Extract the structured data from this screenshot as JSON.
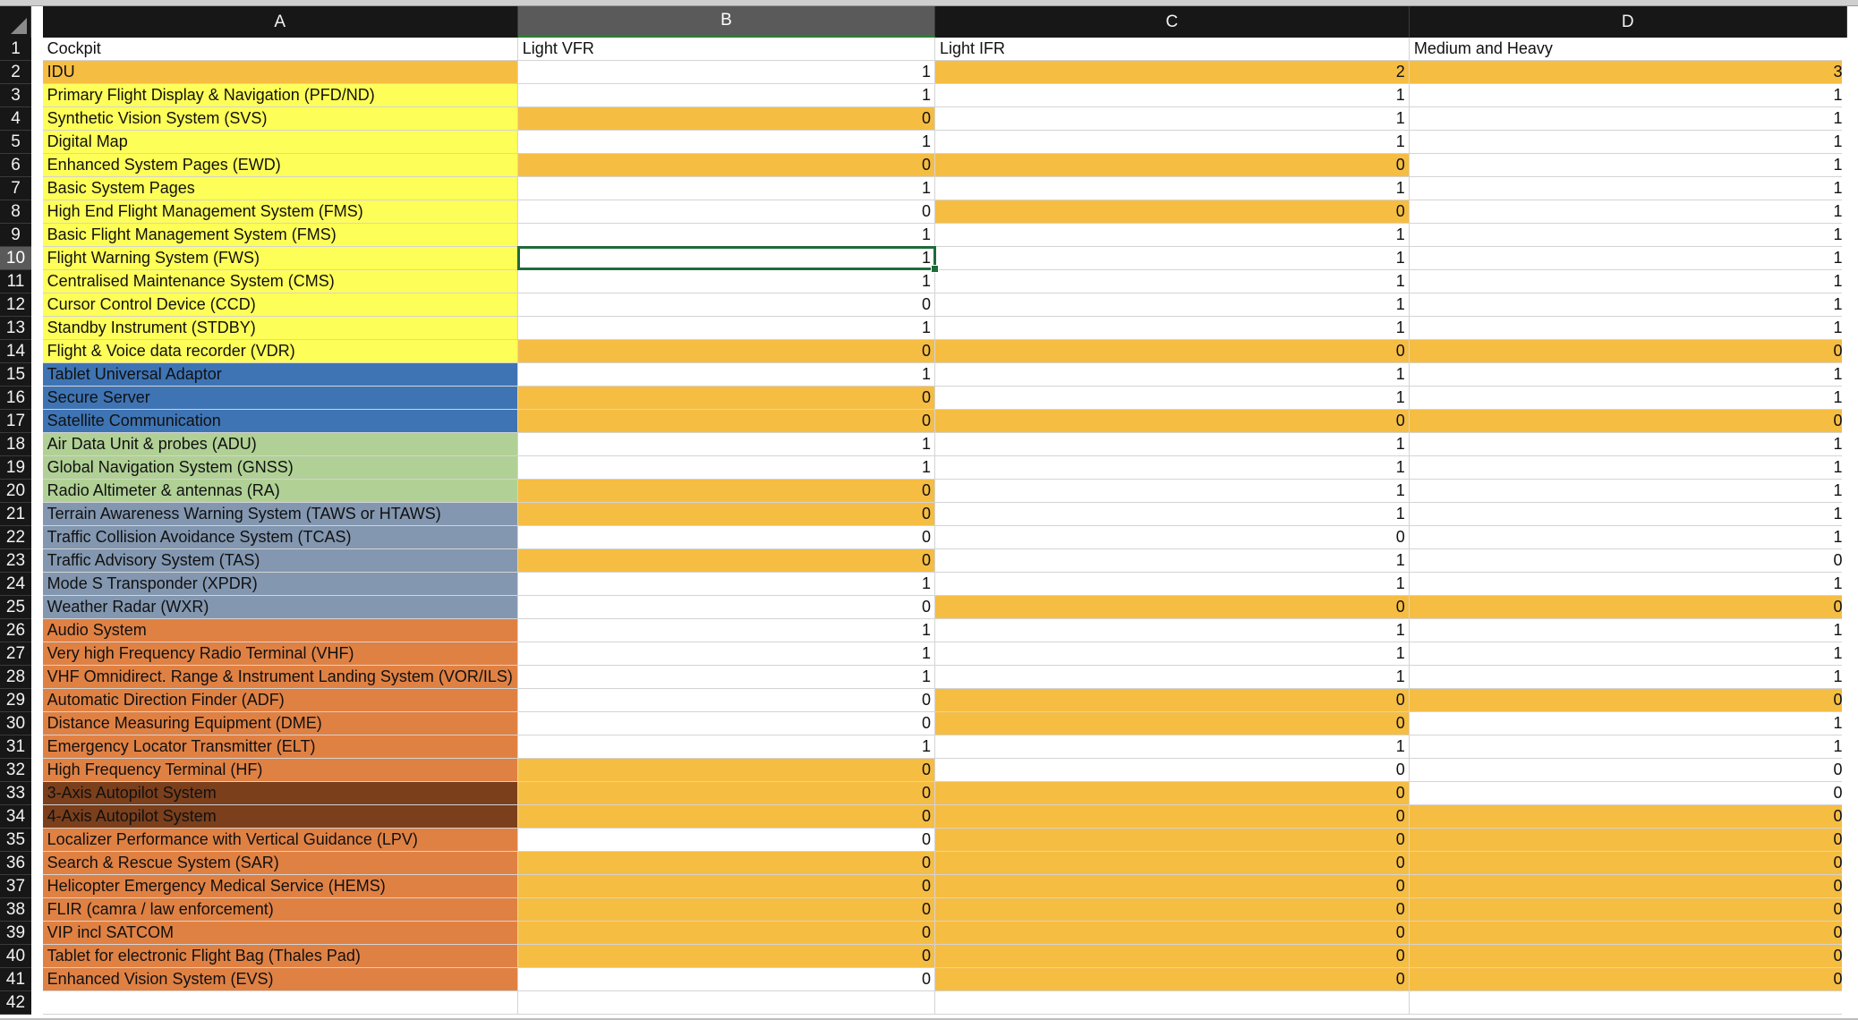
{
  "columns": [
    "A",
    "B",
    "C",
    "D"
  ],
  "selected_column": "B",
  "selected_row": 10,
  "colors": {
    "orange": "#f6bd43",
    "yellow": "#fefe58",
    "blue": "#3f74b4",
    "green": "#b0d095",
    "slate": "#8397b0",
    "copper": "#e08144",
    "brown": "#7b3f1c",
    "white": "#ffffff",
    "selection": "#1e6b3a"
  },
  "rows": [
    {
      "n": 1,
      "a": "Cockpit",
      "b": "Light VFR",
      "c": "Light IFR",
      "d": "Medium and Heavy",
      "fa": "white",
      "fb": "white",
      "fc": "white",
      "fd": "white",
      "header": true
    },
    {
      "n": 2,
      "a": "IDU",
      "b": "1",
      "c": "2",
      "d": "3",
      "fa": "orange",
      "fb": "white",
      "fc": "orange",
      "fd": "orange"
    },
    {
      "n": 3,
      "a": "Primary Flight Display & Navigation (PFD/ND)",
      "b": "1",
      "c": "1",
      "d": "1",
      "fa": "yellow",
      "fb": "white",
      "fc": "white",
      "fd": "white"
    },
    {
      "n": 4,
      "a": "Synthetic Vision System (SVS)",
      "b": "0",
      "c": "1",
      "d": "1",
      "fa": "yellow",
      "fb": "orange",
      "fc": "white",
      "fd": "white"
    },
    {
      "n": 5,
      "a": "Digital Map",
      "b": "1",
      "c": "1",
      "d": "1",
      "fa": "yellow",
      "fb": "white",
      "fc": "white",
      "fd": "white"
    },
    {
      "n": 6,
      "a": "Enhanced System Pages (EWD)",
      "b": "0",
      "c": "0",
      "d": "1",
      "fa": "yellow",
      "fb": "orange",
      "fc": "orange",
      "fd": "white"
    },
    {
      "n": 7,
      "a": "Basic System Pages",
      "b": "1",
      "c": "1",
      "d": "1",
      "fa": "yellow",
      "fb": "white",
      "fc": "white",
      "fd": "white"
    },
    {
      "n": 8,
      "a": "High End Flight Management System (FMS)",
      "b": "0",
      "c": "0",
      "d": "1",
      "fa": "yellow",
      "fb": "white",
      "fc": "orange",
      "fd": "white"
    },
    {
      "n": 9,
      "a": "Basic Flight Management System (FMS)",
      "b": "1",
      "c": "1",
      "d": "1",
      "fa": "yellow",
      "fb": "white",
      "fc": "white",
      "fd": "white"
    },
    {
      "n": 10,
      "a": "Flight Warning System (FWS)",
      "b": "1",
      "c": "1",
      "d": "1",
      "fa": "yellow",
      "fb": "white",
      "fc": "white",
      "fd": "white"
    },
    {
      "n": 11,
      "a": "Centralised Maintenance System (CMS)",
      "b": "1",
      "c": "1",
      "d": "1",
      "fa": "yellow",
      "fb": "white",
      "fc": "white",
      "fd": "white"
    },
    {
      "n": 12,
      "a": "Cursor Control Device (CCD)",
      "b": "0",
      "c": "1",
      "d": "1",
      "fa": "yellow",
      "fb": "white",
      "fc": "white",
      "fd": "white"
    },
    {
      "n": 13,
      "a": "Standby Instrument (STDBY)",
      "b": "1",
      "c": "1",
      "d": "1",
      "fa": "yellow",
      "fb": "white",
      "fc": "white",
      "fd": "white"
    },
    {
      "n": 14,
      "a": "Flight & Voice data recorder (VDR)",
      "b": "0",
      "c": "0",
      "d": "0",
      "fa": "yellow",
      "fb": "orange",
      "fc": "orange",
      "fd": "orange"
    },
    {
      "n": 15,
      "a": "Tablet Universal Adaptor",
      "b": "1",
      "c": "1",
      "d": "1",
      "fa": "blue",
      "fb": "white",
      "fc": "white",
      "fd": "white"
    },
    {
      "n": 16,
      "a": "Secure Server",
      "b": "0",
      "c": "1",
      "d": "1",
      "fa": "blue",
      "fb": "orange",
      "fc": "white",
      "fd": "white"
    },
    {
      "n": 17,
      "a": "Satellite Communication",
      "b": "0",
      "c": "0",
      "d": "0",
      "fa": "blue",
      "fb": "orange",
      "fc": "orange",
      "fd": "orange"
    },
    {
      "n": 18,
      "a": "Air Data Unit & probes (ADU)",
      "b": "1",
      "c": "1",
      "d": "1",
      "fa": "green",
      "fb": "white",
      "fc": "white",
      "fd": "white"
    },
    {
      "n": 19,
      "a": "Global Navigation System (GNSS)",
      "b": "1",
      "c": "1",
      "d": "1",
      "fa": "green",
      "fb": "white",
      "fc": "white",
      "fd": "white"
    },
    {
      "n": 20,
      "a": "Radio Altimeter & antennas (RA)",
      "b": "0",
      "c": "1",
      "d": "1",
      "fa": "green",
      "fb": "orange",
      "fc": "white",
      "fd": "white"
    },
    {
      "n": 21,
      "a": "Terrain Awareness Warning System (TAWS or HTAWS)",
      "b": "0",
      "c": "1",
      "d": "1",
      "fa": "slate",
      "fb": "orange",
      "fc": "white",
      "fd": "white"
    },
    {
      "n": 22,
      "a": "Traffic Collision Avoidance System (TCAS)",
      "b": "0",
      "c": "0",
      "d": "1",
      "fa": "slate",
      "fb": "white",
      "fc": "white",
      "fd": "white"
    },
    {
      "n": 23,
      "a": "Traffic Advisory System (TAS)",
      "b": "0",
      "c": "1",
      "d": "0",
      "fa": "slate",
      "fb": "orange",
      "fc": "white",
      "fd": "white"
    },
    {
      "n": 24,
      "a": "Mode S Transponder (XPDR)",
      "b": "1",
      "c": "1",
      "d": "1",
      "fa": "slate",
      "fb": "white",
      "fc": "white",
      "fd": "white"
    },
    {
      "n": 25,
      "a": "Weather Radar (WXR)",
      "b": "0",
      "c": "0",
      "d": "0",
      "fa": "slate",
      "fb": "white",
      "fc": "orange",
      "fd": "orange"
    },
    {
      "n": 26,
      "a": "Audio System",
      "b": "1",
      "c": "1",
      "d": "1",
      "fa": "copper",
      "fb": "white",
      "fc": "white",
      "fd": "white"
    },
    {
      "n": 27,
      "a": "Very high Frequency Radio Terminal (VHF)",
      "b": "1",
      "c": "1",
      "d": "1",
      "fa": "copper",
      "fb": "white",
      "fc": "white",
      "fd": "white"
    },
    {
      "n": 28,
      "a": "VHF Omnidirect. Range & Instrument Landing System (VOR/ILS)",
      "b": "1",
      "c": "1",
      "d": "1",
      "fa": "copper",
      "fb": "white",
      "fc": "white",
      "fd": "white"
    },
    {
      "n": 29,
      "a": "Automatic Direction Finder (ADF)",
      "b": "0",
      "c": "0",
      "d": "0",
      "fa": "copper",
      "fb": "white",
      "fc": "orange",
      "fd": "orange"
    },
    {
      "n": 30,
      "a": "Distance Measuring Equipment (DME)",
      "b": "0",
      "c": "0",
      "d": "1",
      "fa": "copper",
      "fb": "white",
      "fc": "orange",
      "fd": "white"
    },
    {
      "n": 31,
      "a": "Emergency Locator Transmitter (ELT)",
      "b": "1",
      "c": "1",
      "d": "1",
      "fa": "copper",
      "fb": "white",
      "fc": "white",
      "fd": "white"
    },
    {
      "n": 32,
      "a": "High Frequency Terminal (HF)",
      "b": "0",
      "c": "0",
      "d": "0",
      "fa": "copper",
      "fb": "orange",
      "fc": "white",
      "fd": "white"
    },
    {
      "n": 33,
      "a": "3-Axis Autopilot System",
      "b": "0",
      "c": "0",
      "d": "0",
      "fa": "brown",
      "fb": "orange",
      "fc": "orange",
      "fd": "white"
    },
    {
      "n": 34,
      "a": "4-Axis Autopilot System",
      "b": "0",
      "c": "0",
      "d": "0",
      "fa": "brown",
      "fb": "orange",
      "fc": "orange",
      "fd": "orange"
    },
    {
      "n": 35,
      "a": "Localizer Performance with Vertical Guidance (LPV)",
      "b": "0",
      "c": "0",
      "d": "0",
      "fa": "copper",
      "fb": "white",
      "fc": "orange",
      "fd": "orange"
    },
    {
      "n": 36,
      "a": "Search & Rescue System (SAR)",
      "b": "0",
      "c": "0",
      "d": "0",
      "fa": "copper",
      "fb": "orange",
      "fc": "orange",
      "fd": "orange"
    },
    {
      "n": 37,
      "a": "Helicopter Emergency Medical Service (HEMS)",
      "b": "0",
      "c": "0",
      "d": "0",
      "fa": "copper",
      "fb": "orange",
      "fc": "orange",
      "fd": "orange"
    },
    {
      "n": 38,
      "a": "FLIR (camra / law enforcement)",
      "b": "0",
      "c": "0",
      "d": "0",
      "fa": "copper",
      "fb": "orange",
      "fc": "orange",
      "fd": "orange"
    },
    {
      "n": 39,
      "a": "VIP incl SATCOM",
      "b": "0",
      "c": "0",
      "d": "0",
      "fa": "copper",
      "fb": "orange",
      "fc": "orange",
      "fd": "orange"
    },
    {
      "n": 40,
      "a": "Tablet for electronic Flight Bag (Thales Pad)",
      "b": "0",
      "c": "0",
      "d": "0",
      "fa": "copper",
      "fb": "orange",
      "fc": "orange",
      "fd": "orange"
    },
    {
      "n": 41,
      "a": "Enhanced Vision System (EVS)",
      "b": "0",
      "c": "0",
      "d": "0",
      "fa": "copper",
      "fb": "white",
      "fc": "orange",
      "fd": "orange"
    },
    {
      "n": 42,
      "a": "",
      "b": "",
      "c": "",
      "d": "",
      "fa": "white",
      "fb": "white",
      "fc": "white",
      "fd": "white"
    }
  ]
}
